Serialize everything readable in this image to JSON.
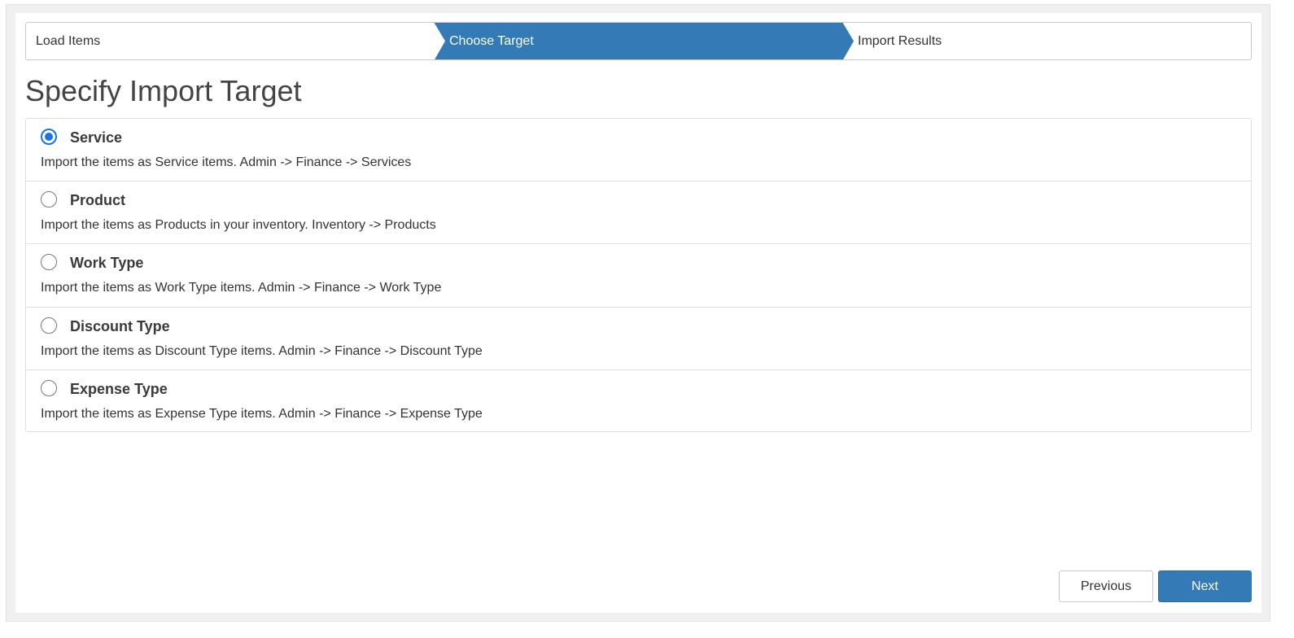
{
  "wizard": {
    "steps": [
      {
        "label": "Load Items",
        "active": false
      },
      {
        "label": "Choose Target",
        "active": true
      },
      {
        "label": "Import Results",
        "active": false
      }
    ],
    "active_color": "#337ab7"
  },
  "page": {
    "title": "Specify Import Target"
  },
  "options": [
    {
      "title": "Service",
      "description": "Import the items as Service items. Admin -> Finance -> Services",
      "checked": true
    },
    {
      "title": "Product",
      "description": "Import the items as Products in your inventory. Inventory -> Products",
      "checked": false
    },
    {
      "title": "Work Type",
      "description": "Import the items as Work Type items. Admin -> Finance -> Work Type",
      "checked": false
    },
    {
      "title": "Discount Type",
      "description": "Import the items as Discount Type items. Admin -> Finance -> Discount Type",
      "checked": false
    },
    {
      "title": "Expense Type",
      "description": "Import the items as Expense Type items. Admin -> Finance -> Expense Type",
      "checked": false
    }
  ],
  "buttons": {
    "previous_label": "Previous",
    "next_label": "Next"
  },
  "colors": {
    "radio_checked": "#1a73e8",
    "primary_button": "#337ab7"
  }
}
